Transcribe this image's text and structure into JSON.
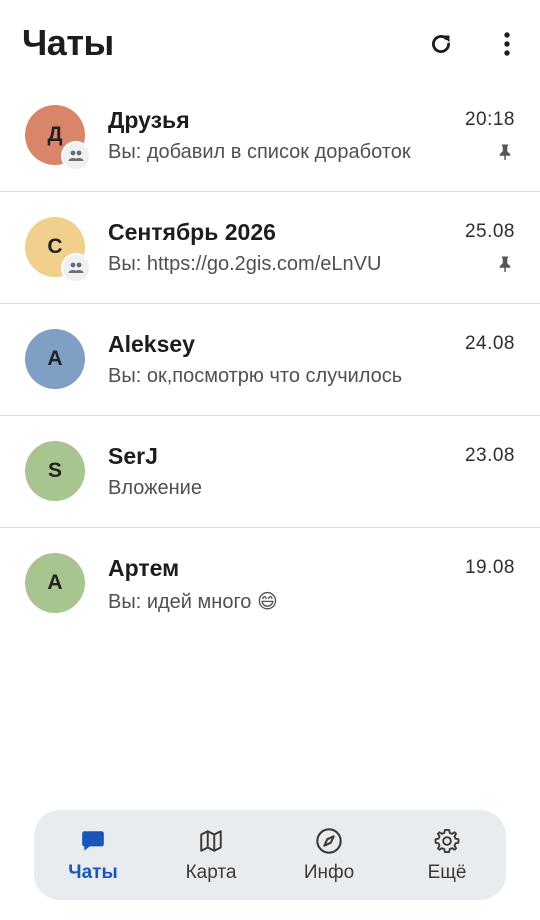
{
  "header": {
    "title": "Чаты",
    "refresh_icon": "refresh-icon",
    "more_icon": "more-vertical-icon"
  },
  "chats": [
    {
      "name": "Друзья",
      "initial": "Д",
      "time": "20:18",
      "preview": "Вы: добавил в список доработок",
      "avatar_color": "#d9856a",
      "group": true,
      "pinned": true
    },
    {
      "name": "Сентябрь 2026",
      "initial": "С",
      "time": "25.08",
      "preview": "Вы: https://go.2gis.com/eLnVU",
      "avatar_color": "#f0d08c",
      "group": true,
      "pinned": true
    },
    {
      "name": "Aleksey",
      "initial": "A",
      "time": "24.08",
      "preview": "Вы: ок,посмотрю что случилось",
      "avatar_color": "#7f9fc4",
      "group": false,
      "pinned": false
    },
    {
      "name": "SerJ",
      "initial": "S",
      "time": "23.08",
      "preview": "Вложение",
      "avatar_color": "#a8c48f",
      "group": false,
      "pinned": false
    },
    {
      "name": "Артем",
      "initial": "A",
      "time": "19.08",
      "preview": "Вы: идей много 😄",
      "avatar_color": "#a8c48f",
      "group": false,
      "pinned": false
    }
  ],
  "bottom_nav": [
    {
      "label": "Чаты",
      "icon": "chat-bubble-icon",
      "active": true
    },
    {
      "label": "Карта",
      "icon": "map-icon",
      "active": false
    },
    {
      "label": "Инфо",
      "icon": "compass-icon",
      "active": false
    },
    {
      "label": "Ещё",
      "icon": "settings-gear-icon",
      "active": false
    }
  ],
  "colors": {
    "accent": "#1a56b8",
    "nav_background": "#e9ecef",
    "divider": "#d9d9d9"
  }
}
